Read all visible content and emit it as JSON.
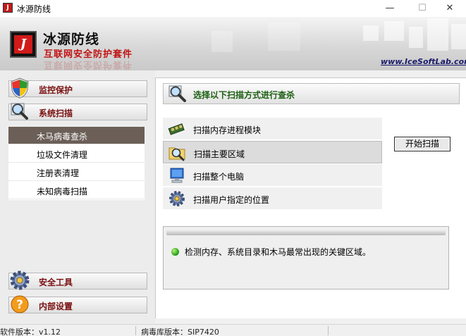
{
  "window": {
    "title": "冰源防线",
    "icon_text": "J",
    "controls": {
      "minimize": "—",
      "maximize": "☐",
      "close": "✕"
    }
  },
  "header": {
    "brand_name": "冰源防线",
    "brand_subtitle": "互联网安全防护套件",
    "website": "www.IceSoftLab.com",
    "logo_text": "J"
  },
  "sidebar": {
    "categories": [
      {
        "label": "监控保护",
        "icon": "shield-icon"
      },
      {
        "label": "系统扫描",
        "icon": "magnifier-icon"
      },
      {
        "label": "安全工具",
        "icon": "gear-icon"
      },
      {
        "label": "内部设置",
        "icon": "question-icon"
      }
    ],
    "scan_items": [
      {
        "label": "木马病毒查杀",
        "active": true
      },
      {
        "label": "垃圾文件清理",
        "active": false
      },
      {
        "label": "注册表清理",
        "active": false
      },
      {
        "label": "未知病毒扫描",
        "active": false
      }
    ]
  },
  "main": {
    "title": "选择以下扫描方式进行查杀",
    "options": [
      {
        "label": "扫描内存进程模块",
        "icon": "memory-chip-icon",
        "selected": false
      },
      {
        "label": "扫描主要区域",
        "icon": "folder-search-icon",
        "selected": true
      },
      {
        "label": "扫描整个电脑",
        "icon": "computer-icon",
        "selected": false
      },
      {
        "label": "扫描用户指定的位置",
        "icon": "gear-location-icon",
        "selected": false
      }
    ],
    "start_button": "开始扫描",
    "description": "检测内存、系统目录和木马最常出现的关键区域。"
  },
  "status": {
    "software_version": "软件版本：v1.12",
    "virus_db_version": "病毒库版本：SIP7420"
  },
  "colors": {
    "accent_red": "#c11212",
    "category_label": "#7a0f0f",
    "title_green": "#1b5e10",
    "active_item_bg": "#6b5f57"
  }
}
